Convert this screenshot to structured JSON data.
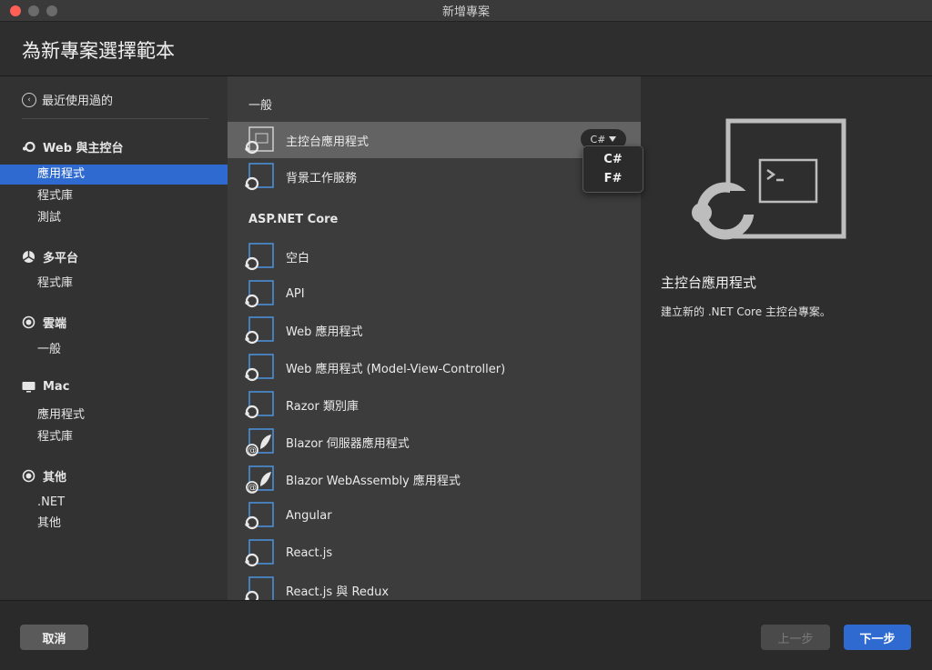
{
  "window": {
    "title": "新增專案"
  },
  "header": {
    "title": "為新專案選擇範本"
  },
  "sidebar": {
    "recent_label": "最近使用過的",
    "categories": [
      {
        "label": "Web 與主控台",
        "icon": "dotnet-icon",
        "items": [
          "應用程式",
          "程式庫",
          "測試"
        ],
        "selected": 0
      },
      {
        "label": "多平台",
        "icon": "multiplatform-icon",
        "items": [
          "程式庫"
        ]
      },
      {
        "label": "雲端",
        "icon": "cloud-icon",
        "items": [
          "一般"
        ]
      },
      {
        "label": "Mac",
        "icon": "monitor-icon",
        "items": [
          "應用程式",
          "程式庫"
        ]
      },
      {
        "label": "其他",
        "icon": "other-icon",
        "items": [
          ".NET",
          "其他"
        ]
      }
    ]
  },
  "templates": {
    "group_general": "一般",
    "group_aspnet": "ASP.NET Core",
    "general": [
      {
        "label": "主控台應用程式",
        "icon": "console-app-icon",
        "selected": true
      },
      {
        "label": "背景工作服務",
        "icon": "project-template-icon"
      }
    ],
    "aspnet": [
      {
        "label": "空白",
        "icon": "project-template-icon"
      },
      {
        "label": "API",
        "icon": "project-template-icon"
      },
      {
        "label": "Web 應用程式",
        "icon": "project-template-icon"
      },
      {
        "label": "Web 應用程式 (Model-View-Controller)",
        "icon": "project-template-icon"
      },
      {
        "label": "Razor 類別庫",
        "icon": "project-template-icon"
      },
      {
        "label": "Blazor 伺服器應用程式",
        "icon": "blazor-icon"
      },
      {
        "label": "Blazor WebAssembly 應用程式",
        "icon": "blazor-icon"
      },
      {
        "label": "Angular",
        "icon": "project-template-icon"
      },
      {
        "label": "React.js",
        "icon": "project-template-icon"
      },
      {
        "label": "React.js 與 Redux",
        "icon": "project-template-icon"
      }
    ],
    "language_selected": "C#",
    "language_options": [
      "C#",
      "F#"
    ]
  },
  "detail": {
    "title": "主控台應用程式",
    "description": "建立新的 .NET Core 主控台專案。"
  },
  "footer": {
    "cancel": "取消",
    "previous": "上一步",
    "next": "下一步"
  },
  "colors": {
    "accent": "#2f6ad0",
    "selected_row": "#636363"
  }
}
